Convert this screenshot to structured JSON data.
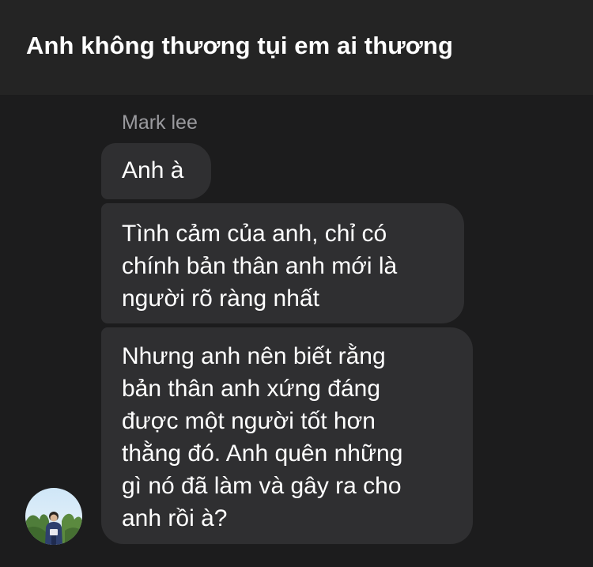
{
  "header": {
    "title": "Anh không thương tụi em ai thương"
  },
  "conversation": {
    "sender_name": "Mark lee",
    "messages": [
      {
        "text": "Anh à"
      },
      {
        "text": "Tình cảm của anh, chỉ có\nchính bản thân anh mới là\nngười rõ ràng nhất"
      },
      {
        "text": "Nhưng anh nên biết rằng\nbản thân anh xứng đáng\nđược một người tốt hơn\nthằng đó. Anh quên những\ngì nó đã làm và gây ra cho\nanh rồi à?"
      }
    ]
  },
  "colors": {
    "header_bg": "#242424",
    "chat_bg": "#1c1c1d",
    "bubble_bg": "#2f2f31",
    "sender_text": "#9a9a9e",
    "message_text": "#ffffff"
  }
}
